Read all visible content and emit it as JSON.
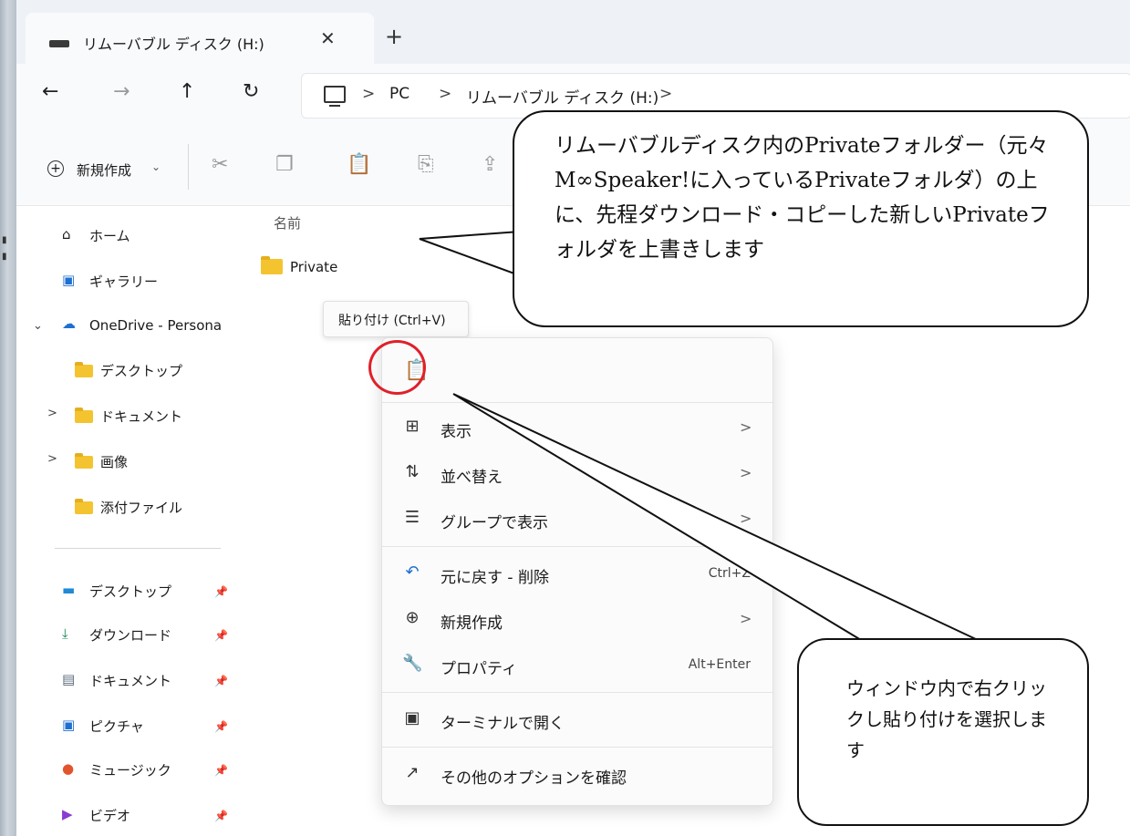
{
  "tab": {
    "title": "リムーバブル ディスク (H:)",
    "close": "✕",
    "add": "+"
  },
  "nav": {
    "back": "←",
    "forward": "→",
    "up": "↑",
    "refresh": "↻"
  },
  "address": {
    "crumbs": [
      "PC",
      "リムーバブル ディスク (H:)"
    ],
    "sep": ">"
  },
  "toolbar": {
    "new_label": "新規作成",
    "new_caret": "⌄"
  },
  "sidebar": {
    "home": "ホーム",
    "gallery": "ギャラリー",
    "onedrive": "OneDrive - Persona",
    "od_items": [
      "デスクトップ",
      "ドキュメント",
      "画像",
      "添付ファイル"
    ],
    "quick": [
      "デスクトップ",
      "ダウンロード",
      "ドキュメント",
      "ピクチャ",
      "ミュージック",
      "ビデオ"
    ]
  },
  "content": {
    "column_name": "名前",
    "folder_name": "Private"
  },
  "tooltip": "貼り付け (Ctrl+V)",
  "context_menu": {
    "items": [
      {
        "label": "表示",
        "icon": "⊞"
      },
      {
        "label": "並べ替え",
        "icon": "⇅"
      },
      {
        "label": "グループで表示",
        "icon": "☰"
      },
      {
        "label": "元に戻す - 削除",
        "icon": "↶",
        "shortcut": "Ctrl+Z"
      },
      {
        "label": "新規作成",
        "icon": "⊕"
      },
      {
        "label": "プロパティ",
        "icon": "🔧",
        "shortcut": "Alt+Enter"
      },
      {
        "label": "ターミナルで開く",
        "icon": "▣"
      },
      {
        "label": "その他のオプションを確認",
        "icon": "↗"
      }
    ]
  },
  "annotations": {
    "top": "リムーバブルディスク内のPrivateフォルダー（元々M∞Speaker!に入っているPrivateフォルダ）の上に、先程ダウンロード・コピーした新しいPrivateフォルダを上書きします",
    "bottom": "ウィンドウ内で右クリックし貼り付けを選択します"
  },
  "colors": {
    "highlight": "#e0202a",
    "folder": "#f4c430"
  }
}
